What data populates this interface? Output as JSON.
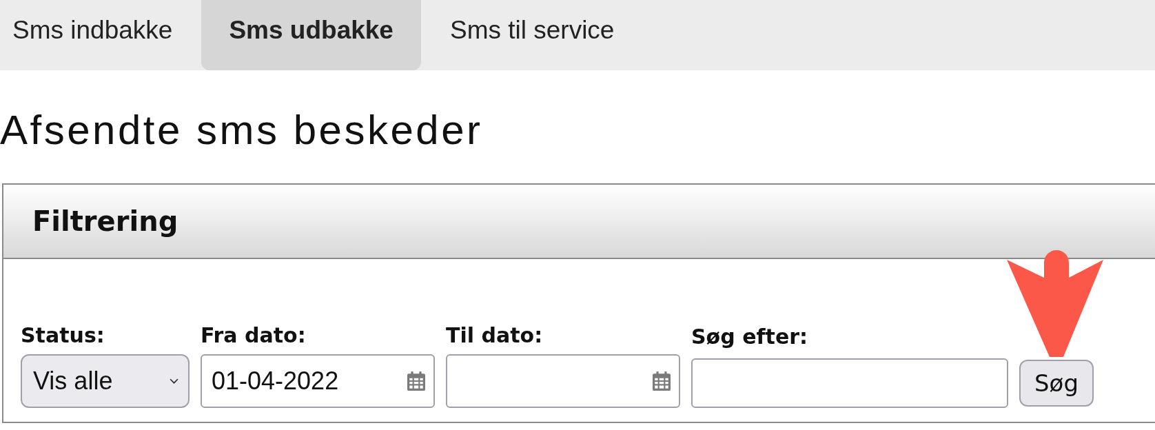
{
  "tabs": [
    {
      "label": "Sms indbakke",
      "selected": false
    },
    {
      "label": "Sms udbakke",
      "selected": true
    },
    {
      "label": "Sms til service",
      "selected": false
    }
  ],
  "heading": "Afsendte sms beskeder",
  "filter_panel": {
    "title": "Filtrering",
    "fields": [
      {
        "kind": "select",
        "label": "Status:",
        "value": "Vis alle"
      },
      {
        "kind": "date",
        "label": "Fra dato:",
        "value": "01-04-2022"
      },
      {
        "kind": "date",
        "label": "Til dato:"
      },
      {
        "kind": "text",
        "label": "Søg efter:"
      }
    ],
    "button": "Søg"
  }
}
